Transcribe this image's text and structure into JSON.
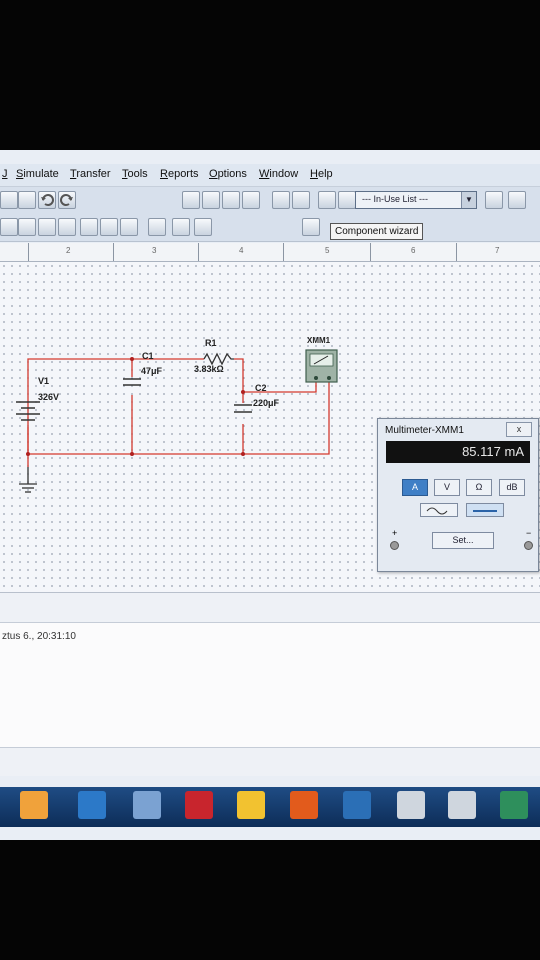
{
  "menu": [
    "Simulate",
    "Transfer",
    "Tools",
    "Reports",
    "Options",
    "Window",
    "Help"
  ],
  "menu_left_fragment": "J",
  "toolbar": {
    "inuse_list": "--- In-Use List ---"
  },
  "tooltip": "Component wizard",
  "ruler_numbers": [
    "2",
    "3",
    "4",
    "5",
    "6",
    "7"
  ],
  "circuit": {
    "v1_name": "V1",
    "v1_value": "326V",
    "c1_name": "C1",
    "c1_value": "47μF",
    "r1_name": "R1",
    "r1_value": "3.83kΩ",
    "c2_name": "C2",
    "c2_value": "220μF",
    "xmm_name": "XMM1"
  },
  "multimeter": {
    "title": "Multimeter-XMM1",
    "close": "x",
    "reading": "85.117 mA",
    "buttons": [
      "A",
      "V",
      "Ω",
      "dB"
    ],
    "selected_mode": "A",
    "set_label": "Set...",
    "plus": "+",
    "minus": "−"
  },
  "log": {
    "line": "ztus 6., 20:31:10"
  },
  "colors": {
    "wire": "#d3392f",
    "display_bg": "#111111",
    "taskbar": "#1a4279"
  }
}
